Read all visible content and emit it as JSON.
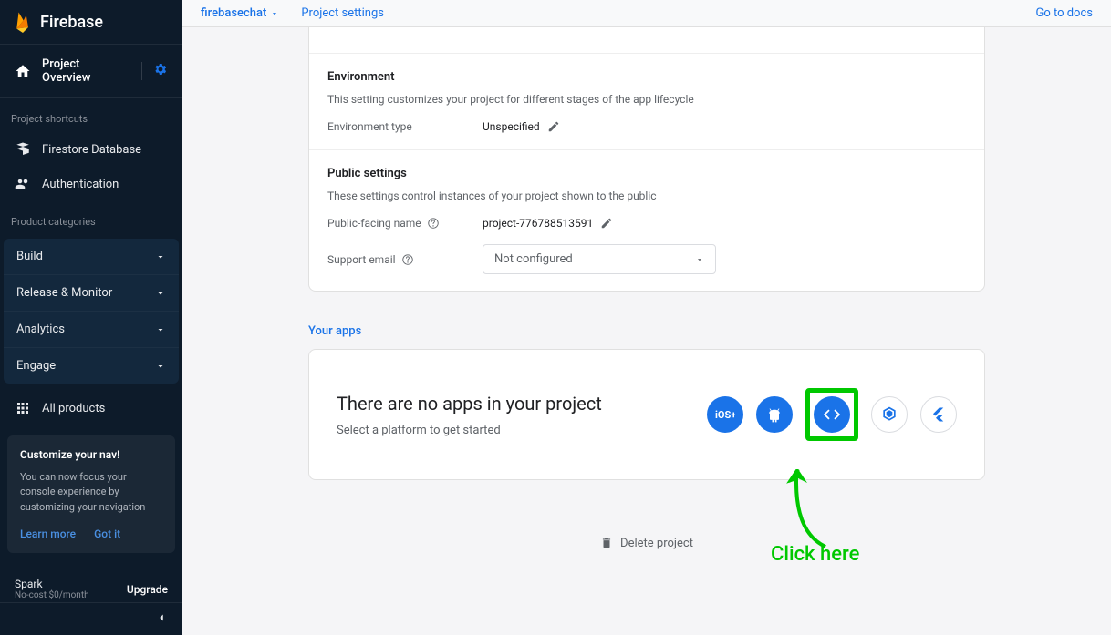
{
  "brand": "Firebase",
  "sidebar": {
    "overview": "Project Overview",
    "shortcuts_title": "Project shortcuts",
    "shortcuts": [
      {
        "label": "Firestore Database"
      },
      {
        "label": "Authentication"
      }
    ],
    "categories_title": "Product categories",
    "categories": [
      {
        "label": "Build"
      },
      {
        "label": "Release & Monitor"
      },
      {
        "label": "Analytics"
      },
      {
        "label": "Engage"
      }
    ],
    "all_products": "All products",
    "nav_card": {
      "title": "Customize your nav!",
      "desc": "You can now focus your console experience by customizing your navigation",
      "learn": "Learn more",
      "got_it": "Got it"
    },
    "plan": {
      "name": "Spark",
      "sub": "No-cost $0/month",
      "upgrade": "Upgrade"
    }
  },
  "topbar": {
    "project": "firebasechat",
    "settings": "Project settings",
    "docs": "Go to docs"
  },
  "settings": {
    "env": {
      "title": "Environment",
      "desc": "This setting customizes your project for different stages of the app lifecycle",
      "type_label": "Environment type",
      "type_value": "Unspecified"
    },
    "public": {
      "title": "Public settings",
      "desc": "These settings control instances of your project shown to the public",
      "name_label": "Public-facing name",
      "name_value": "project-776788513591",
      "email_label": "Support email",
      "email_value": "Not configured"
    }
  },
  "apps": {
    "header": "Your apps",
    "title": "There are no apps in your project",
    "sub": "Select a platform to get started"
  },
  "delete": "Delete project",
  "annotation": "Click here"
}
